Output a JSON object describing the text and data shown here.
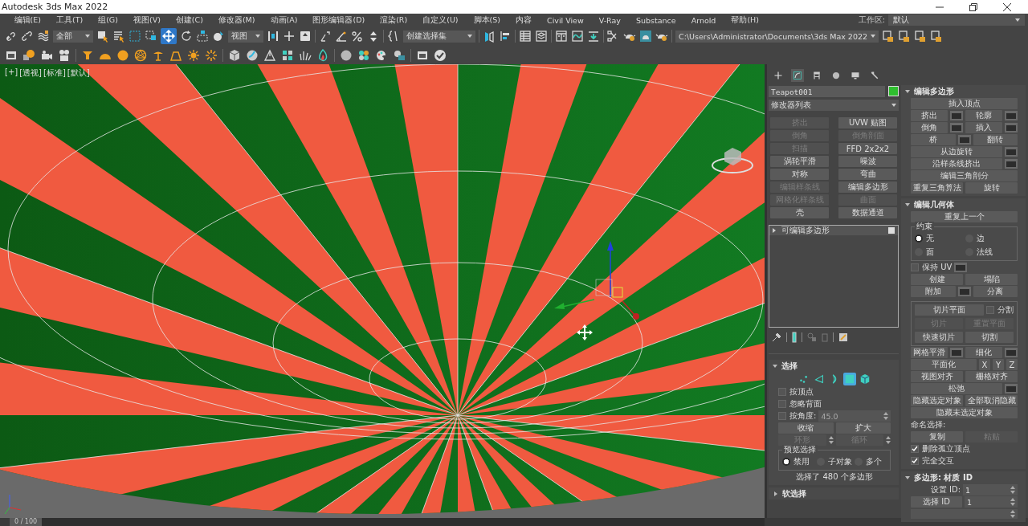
{
  "window": {
    "title": "Autodesk 3ds Max 2022"
  },
  "menu": [
    "编辑(E)",
    "工具(T)",
    "组(G)",
    "视图(V)",
    "创建(C)",
    "修改器(M)",
    "动画(A)",
    "图形编辑器(D)",
    "渲染(R)",
    "自定义(U)",
    "脚本(S)",
    "内容",
    "Civil View",
    "V-Ray",
    "Substance",
    "Arnold",
    "帮助(H)"
  ],
  "workspace": {
    "label": "工作区:",
    "value": "默认"
  },
  "toolbar": {
    "selection_filter": "全部",
    "reference_coord": "视图",
    "named_selection": "创建选择集",
    "project_path": "C:\\Users\\Administrator\\Documents\\3ds Max 2022"
  },
  "viewport": {
    "labels": [
      "[+]",
      "[透视]",
      "[标准]",
      "[默认]"
    ]
  },
  "command_tabs": [
    {
      "selected": false
    },
    {
      "selected": true
    },
    {
      "selected": false
    },
    {
      "selected": false
    },
    {
      "selected": false
    },
    {
      "selected": false
    }
  ],
  "object": {
    "name": "Teapot001"
  },
  "modifier_list": "修改器列表",
  "modifier_buttons": [
    {
      "label": "挤出",
      "disabled": true
    },
    {
      "label": "UVW 贴图",
      "disabled": false
    },
    {
      "label": "倒角",
      "disabled": true
    },
    {
      "label": "倒角剖面",
      "disabled": true
    },
    {
      "label": "扫描",
      "disabled": true
    },
    {
      "label": "FFD 2x2x2",
      "disabled": false
    },
    {
      "label": "涡轮平滑",
      "disabled": false
    },
    {
      "label": "噪波",
      "disabled": false
    },
    {
      "label": "对称",
      "disabled": false
    },
    {
      "label": "弯曲",
      "disabled": false
    },
    {
      "label": "编辑样条线",
      "disabled": true
    },
    {
      "label": "编辑多边形",
      "disabled": false
    },
    {
      "label": "网格化样条线",
      "disabled": true
    },
    {
      "label": "曲面",
      "disabled": true
    },
    {
      "label": "壳",
      "disabled": false
    },
    {
      "label": "数据通道",
      "disabled": false
    }
  ],
  "modifier_stack": [
    {
      "label": "可编辑多边形",
      "expanded": false
    }
  ],
  "left_rollouts": [
    {
      "title": "选择",
      "expanded": true,
      "rows": [
        [
          {
            "kind": "levels",
            "items": [
              {
                "selected": false
              },
              {
                "selected": false
              },
              {
                "selected": false
              },
              {
                "selected": true
              },
              {
                "selected": false
              }
            ]
          }
        ],
        [
          {
            "kind": "checkbox",
            "label": "按顶点",
            "checked": false
          }
        ],
        [
          {
            "kind": "checkbox",
            "label": "忽略背面",
            "checked": false
          }
        ],
        [
          {
            "kind": "checkbox",
            "label": "按角度:",
            "checked": false
          },
          {
            "kind": "spinner",
            "value": "45.0",
            "disabled": true
          }
        ],
        [
          {
            "kind": "button",
            "label": "收缩",
            "disabled": false
          },
          {
            "kind": "button",
            "label": "扩大",
            "disabled": false
          }
        ],
        [
          {
            "kind": "spin_button",
            "label": "环形",
            "disabled": true
          },
          {
            "kind": "spin_button",
            "label": "循环",
            "disabled": true
          }
        ],
        [
          {
            "kind": "group",
            "title": "预览选择",
            "rows": [
              [
                {
                  "kind": "radio",
                  "label": "禁用",
                  "selected": true
                },
                {
                  "kind": "radio",
                  "label": "子对象",
                  "selected": false
                },
                {
                  "kind": "radio",
                  "label": "多个",
                  "selected": false
                }
              ]
            ]
          }
        ],
        [
          {
            "kind": "label",
            "text": "选择了 480 个多边形"
          }
        ]
      ]
    },
    {
      "title": "软选择",
      "expanded": false
    }
  ],
  "right_rollouts": [
    {
      "title": "编辑多边形",
      "expanded": true,
      "rows": [
        [
          {
            "kind": "button",
            "label": "插入顶点",
            "disabled": false
          }
        ],
        [
          {
            "kind": "button",
            "label": "挤出",
            "disabled": false
          },
          {
            "kind": "settings"
          },
          {
            "kind": "button",
            "label": "轮廓",
            "disabled": false
          },
          {
            "kind": "settings"
          }
        ],
        [
          {
            "kind": "button",
            "label": "倒角",
            "disabled": false
          },
          {
            "kind": "settings"
          },
          {
            "kind": "button",
            "label": "插入",
            "disabled": false
          },
          {
            "kind": "settings"
          }
        ],
        [
          {
            "kind": "button",
            "label": "桥",
            "disabled": false
          },
          {
            "kind": "settings"
          },
          {
            "kind": "button",
            "label": "翻转",
            "disabled": false
          }
        ],
        [
          {
            "kind": "button",
            "label": "从边旋转",
            "disabled": false
          },
          {
            "kind": "settings"
          }
        ],
        [
          {
            "kind": "button",
            "label": "沿样条线挤出",
            "disabled": false
          },
          {
            "kind": "settings"
          }
        ],
        [
          {
            "kind": "button",
            "label": "编辑三角剖分",
            "disabled": false
          }
        ],
        [
          {
            "kind": "button",
            "label": "重复三角算法",
            "disabled": false
          },
          {
            "kind": "button",
            "label": "旋转",
            "disabled": false
          }
        ]
      ]
    },
    {
      "title": "编辑几何体",
      "expanded": true,
      "rows": [
        [
          {
            "kind": "button",
            "label": "重复上一个",
            "disabled": false
          }
        ],
        [
          {
            "kind": "group",
            "title": "约束",
            "rows": [
              [
                {
                  "kind": "radio",
                  "label": "无",
                  "selected": true
                },
                {
                  "kind": "radio",
                  "label": "边",
                  "selected": false
                }
              ],
              [
                {
                  "kind": "radio",
                  "label": "面",
                  "selected": false
                },
                {
                  "kind": "radio",
                  "label": "法线",
                  "selected": false
                }
              ]
            ]
          }
        ],
        [
          {
            "kind": "checkbox",
            "label": "保持 UV",
            "checked": false
          },
          {
            "kind": "settings"
          }
        ],
        [
          {
            "kind": "button",
            "label": "创建",
            "disabled": false
          },
          {
            "kind": "button",
            "label": "塌陷",
            "disabled": false
          }
        ],
        [
          {
            "kind": "button",
            "label": "附加",
            "disabled": false
          },
          {
            "kind": "settings"
          },
          {
            "kind": "button",
            "label": "分离",
            "disabled": false
          }
        ],
        [
          {
            "kind": "group",
            "rows": [
              [
                {
                  "kind": "button",
                  "label": "切片平面",
                  "disabled": false
                },
                {
                  "kind": "checkbox",
                  "label": "分割",
                  "checked": false
                }
              ],
              [
                {
                  "kind": "button",
                  "label": "切片",
                  "disabled": true
                },
                {
                  "kind": "button",
                  "label": "重置平面",
                  "disabled": true
                }
              ],
              [
                {
                  "kind": "button",
                  "label": "快速切片",
                  "disabled": false
                },
                {
                  "kind": "button",
                  "label": "切割",
                  "disabled": false
                }
              ]
            ]
          }
        ],
        [
          {
            "kind": "button",
            "label": "网格平滑",
            "disabled": false
          },
          {
            "kind": "settings"
          },
          {
            "kind": "button",
            "label": "细化",
            "disabled": false
          },
          {
            "kind": "settings"
          }
        ],
        [
          {
            "kind": "button",
            "label": "平面化",
            "disabled": false
          },
          {
            "kind": "small_button",
            "label": "X",
            "disabled": false
          },
          {
            "kind": "small_button",
            "label": "Y",
            "disabled": false
          },
          {
            "kind": "small_button",
            "label": "Z",
            "disabled": false
          }
        ],
        [
          {
            "kind": "button",
            "label": "视图对齐",
            "disabled": false
          },
          {
            "kind": "button",
            "label": "栅格对齐",
            "disabled": false
          }
        ],
        [
          {
            "kind": "button",
            "label": "松弛",
            "disabled": false
          },
          {
            "kind": "settings"
          }
        ],
        [
          {
            "kind": "button",
            "label": "隐藏选定对象",
            "disabled": false
          },
          {
            "kind": "button",
            "label": "全部取消隐藏",
            "disabled": false
          }
        ],
        [
          {
            "kind": "button",
            "label": "隐藏未选定对象",
            "disabled": false
          }
        ],
        [
          {
            "kind": "label",
            "text": "命名选择:"
          }
        ],
        [
          {
            "kind": "button",
            "label": "复制",
            "disabled": false
          },
          {
            "kind": "button",
            "label": "粘贴",
            "disabled": true
          }
        ],
        [
          {
            "kind": "checkbox",
            "label": "删除孤立顶点",
            "checked": true
          }
        ],
        [
          {
            "kind": "checkbox",
            "label": "完全交互",
            "checked": true
          }
        ]
      ]
    },
    {
      "title": "多边形: 材质 ID",
      "expanded": true,
      "rows": [
        [
          {
            "kind": "label",
            "text": "设置 ID:"
          },
          {
            "kind": "spinner",
            "value": "1",
            "disabled": false
          }
        ],
        [
          {
            "kind": "button",
            "label": "选择 ID",
            "disabled": false
          },
          {
            "kind": "spinner",
            "value": "1",
            "disabled": false
          }
        ],
        [
          {
            "kind": "dropdown"
          }
        ]
      ]
    }
  ],
  "time_slider": {
    "label": "0 / 100",
    "level": 0
  }
}
